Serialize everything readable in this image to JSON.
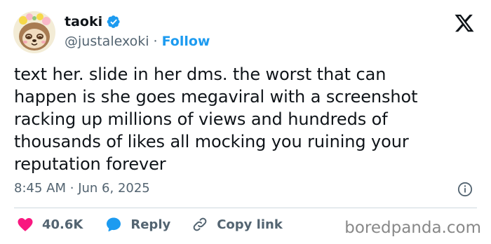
{
  "author": {
    "name": "taoki",
    "handle": "@justalexoki",
    "separator": "·",
    "follow_label": "Follow"
  },
  "tweet": {
    "lines": [
      "text her. slide in her dms. the worst that can",
      "happen is she goes megaviral with a screenshot",
      "racking up millions of views and hundreds of",
      "thousands of likes all mocking you ruining your",
      "reputation forever"
    ],
    "time": "8:45 AM",
    "date": "Jun 6, 2025",
    "meta_separator": "·"
  },
  "actions": {
    "likes": "40.6K",
    "reply_label": "Reply",
    "copy_link_label": "Copy link"
  },
  "watermark": "boredpanda.com",
  "colors": {
    "accent": "#1d9bf0",
    "heart": "#f91880",
    "text": "#0f1419",
    "muted": "#536471"
  },
  "icons": {
    "verified": "verified-badge-icon",
    "platform": "x-logo-icon",
    "info": "info-icon",
    "like": "heart-icon",
    "reply": "reply-bubble-icon",
    "copy": "link-icon"
  }
}
